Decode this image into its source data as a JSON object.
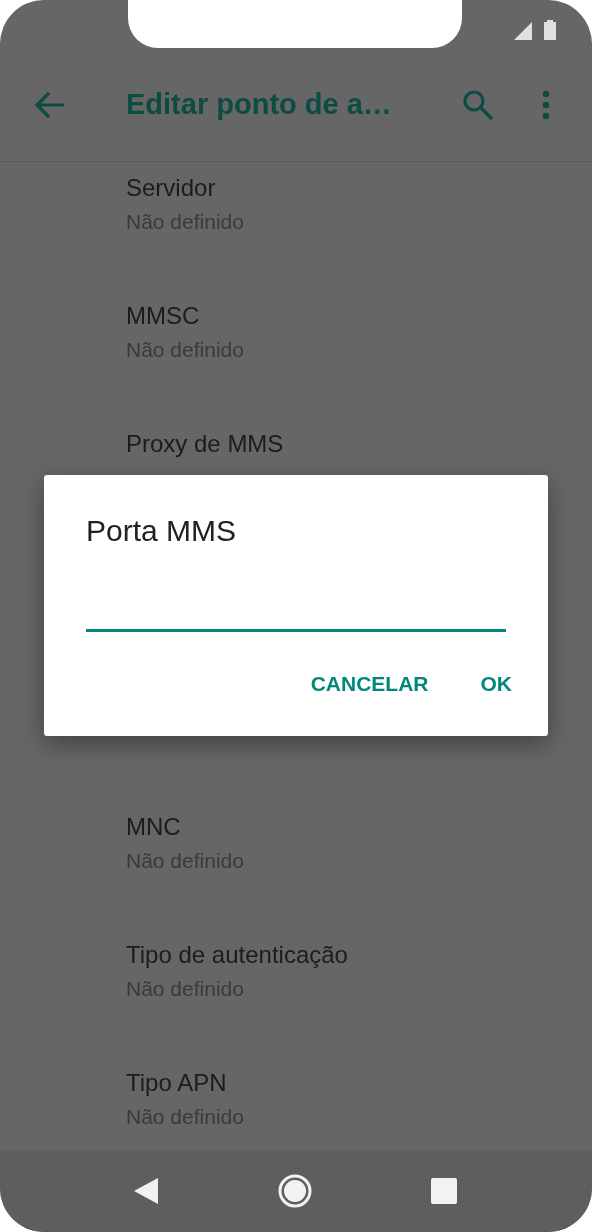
{
  "toolbar": {
    "title": "Editar ponto de a…"
  },
  "list_top": [
    {
      "title": "Servidor",
      "value": "Não definido"
    },
    {
      "title": "MMSC",
      "value": "Não definido"
    },
    {
      "title": "Proxy de MMS"
    }
  ],
  "list_bottom": [
    {
      "title": "MNC",
      "value": "Não definido"
    },
    {
      "title": "Tipo de autenticação",
      "value": "Não definido"
    },
    {
      "title": "Tipo APN",
      "value": "Não definido"
    }
  ],
  "dialog": {
    "title": "Porta MMS",
    "buttons": [
      "CANCELAR",
      "OK"
    ]
  }
}
